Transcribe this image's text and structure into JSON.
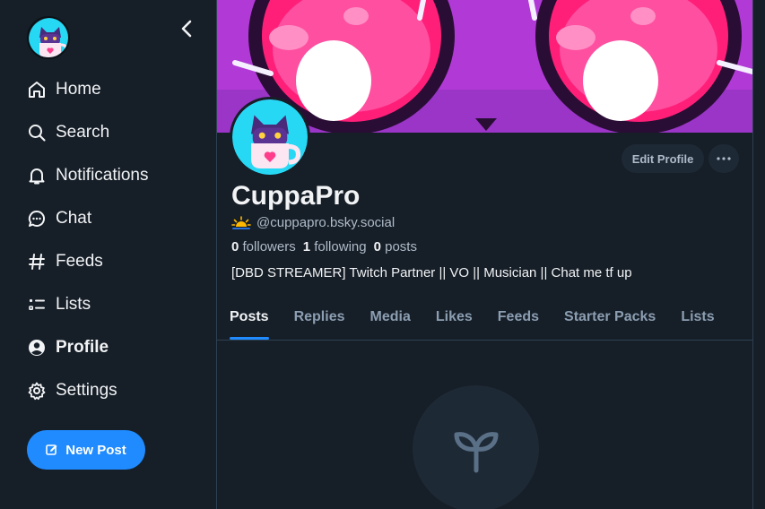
{
  "sidebar": {
    "items": [
      {
        "label": "Home",
        "icon": "home-icon"
      },
      {
        "label": "Search",
        "icon": "search-icon"
      },
      {
        "label": "Notifications",
        "icon": "bell-icon"
      },
      {
        "label": "Chat",
        "icon": "chat-bubble-icon"
      },
      {
        "label": "Feeds",
        "icon": "hashtag-icon"
      },
      {
        "label": "Lists",
        "icon": "list-icon"
      },
      {
        "label": "Profile",
        "icon": "user-circle-icon",
        "active": true
      },
      {
        "label": "Settings",
        "icon": "gear-icon"
      }
    ],
    "new_post_label": "New Post"
  },
  "profile": {
    "display_name": "CuppaPro",
    "handle": "@cuppapro.bsky.social",
    "followers_count": "0",
    "followers_label": "followers",
    "following_count": "1",
    "following_label": "following",
    "posts_count": "0",
    "posts_label": "posts",
    "bio": "[DBD STREAMER] Twitch Partner || VO || Musician || Chat me tf up",
    "edit_label": "Edit Profile"
  },
  "tabs": [
    "Posts",
    "Replies",
    "Media",
    "Likes",
    "Feeds",
    "Starter Packs",
    "Lists"
  ],
  "active_tab": "Posts",
  "colors": {
    "accent": "#208bfe",
    "background": "#161e27",
    "muted_text": "#aebbc9",
    "banner_pink": "#e8197a",
    "banner_purple": "#8d2fb3"
  }
}
